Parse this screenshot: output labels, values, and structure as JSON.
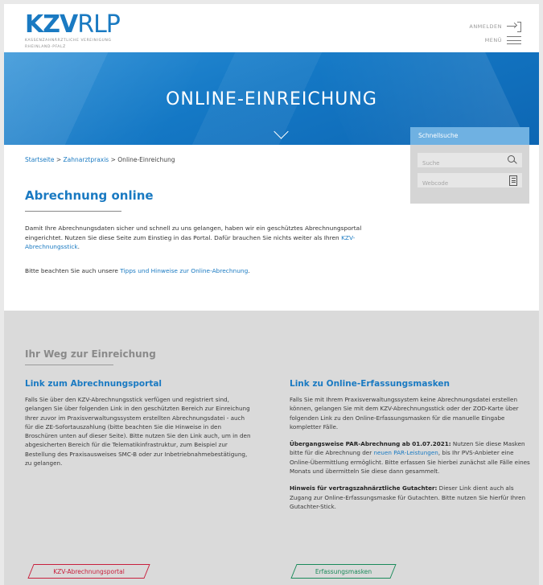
{
  "header": {
    "logo_main": "KZV",
    "logo_accent": "RLP",
    "logo_sub_line1": "KASSENZAHNÄRZTLICHE VEREINIGUNG",
    "logo_sub_line2": "RHEINLAND-PFALZ",
    "login_label": "ANMELDEN",
    "menu_label": "MENÜ"
  },
  "hero": {
    "title": "ONLINE-EINREICHUNG"
  },
  "quick_search": {
    "title": "Schnellsuche",
    "search_placeholder": "Suche",
    "webcode_placeholder": "Webcode"
  },
  "breadcrumb": {
    "home": "Startseite",
    "sep1": " > ",
    "section": "Zahnarztpraxis",
    "sep2": " > ",
    "current": "Online-Einreichung"
  },
  "main": {
    "title": "Abrechnung online",
    "intro_text": "Damit Ihre Abrechnungsdaten sicher und schnell zu uns gelangen, haben wir ein geschütztes Abrechnungsportal eingerichtet. Nutzen Sie diese Seite zum Einstieg in das Portal. Dafür brauchen Sie nichts weiter als Ihren ",
    "intro_link": "KZV-Abrechnungsstick",
    "intro_end": ".",
    "note_text": "Bitte beachten Sie auch unsere ",
    "note_link": "Tipps und Hinweise zur Online-Abrechnung",
    "note_end": "."
  },
  "way": {
    "title": "Ihr Weg zur Einreichung",
    "left": {
      "heading": "Link zum Abrechnungsportal",
      "text": "Falls Sie über den KZV-Abrechnungsstick verfügen und registriert sind, gelangen Sie über folgenden Link in den geschützten Bereich zur Einreichung Ihrer zuvor im Praxisverwaltungssystem erstellten Abrechnungsdatei - auch für die ZE-Sofortauszahlung (bitte beachten Sie die Hinweise in den Broschüren unten auf dieser Seite). Bitte nutzen Sie den Link auch, um in den abgesicherten Bereich für die Telematikinfrastruktur, zum Beispiel zur Bestellung des Praxisausweises SMC-B oder zur Inbetriebnahmebestätigung, zu gelangen.",
      "button": "KZV-Abrechnungsportal"
    },
    "right": {
      "heading": "Link zu Online-Erfassungsmasken",
      "text1": "Falls Sie mit Ihrem Praxisverwaltungssystem keine Abrechnungsdatei erstellen können, gelangen Sie mit dem KZV-Abrechnungsstick oder der ZOD-Karte über folgenden Link zu den Online-Erfassungsmasken für die manuelle Eingabe kompletter Fälle.",
      "par_bold": "Übergangsweise PAR-Abrechnung ab 01.07.2021:",
      "par_text_a": " Nutzen Sie diese Masken bitte für die Abrechnung der ",
      "par_link": "neuen PAR-Leistungen",
      "par_text_b": ", bis Ihr PVS-Anbieter eine Online-Übermittlung ermöglicht. Bitte erfassen Sie hierbei zunächst alle Fälle eines Monats und übermitteln Sie diese dann gesammelt.",
      "hint_bold": "Hinweis für vertragszahnärztliche Gutachter:",
      "hint_text": " Dieser Link dient auch als Zugang zur Online-Erfassungsmaske für Gutachten. Bitte nutzen Sie hierfür Ihren Gutachter-Stick.",
      "button": "Erfassungsmasken"
    }
  },
  "colors": {
    "brand_blue": "#1a7ac2",
    "quick_search_header": "#6fb1e2",
    "button_red": "#c8203d",
    "button_green": "#1a8a5a",
    "section_grey": "#dadada"
  },
  "icons": [
    "login-icon",
    "menu-icon",
    "search-icon",
    "webcode-icon",
    "chevron-down-icon"
  ]
}
